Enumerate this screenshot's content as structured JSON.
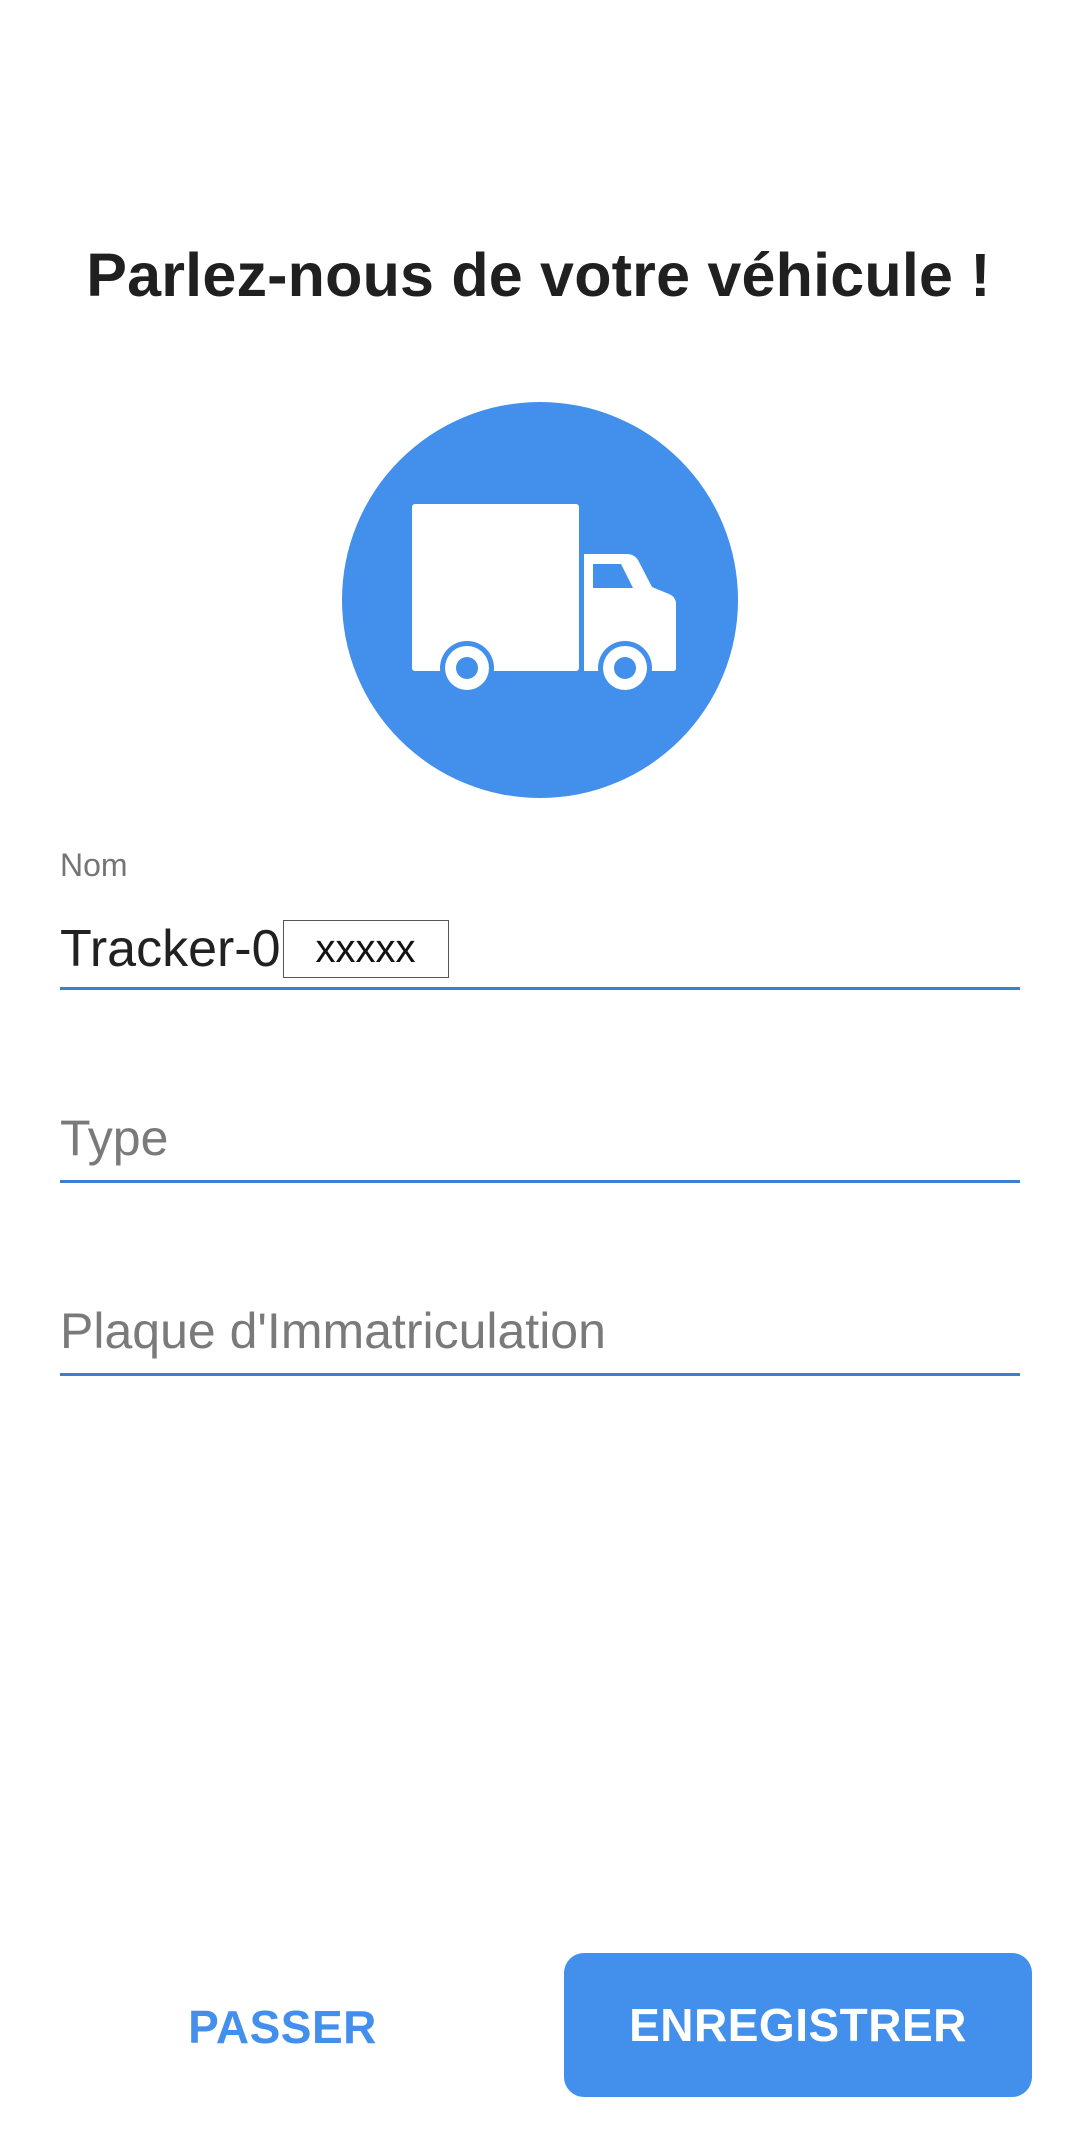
{
  "header": {
    "title": "Parlez-nous de votre véhicule !"
  },
  "vehicle_icon": {
    "icon": "truck-icon",
    "background_color": "#428FEC",
    "foreground_color": "#FFFFFF"
  },
  "form": {
    "name": {
      "label": "Nom",
      "value_prefix": "Tracker-0",
      "value_redacted": "xxxxx"
    },
    "type": {
      "placeholder": "Type"
    },
    "plate": {
      "placeholder": "Plaque d'Immatriculation"
    },
    "underline_color": "#3C7FD0"
  },
  "actions": {
    "skip_label": "PASSER",
    "save_label": "ENREGISTRER",
    "accent_color": "#428FEC"
  }
}
